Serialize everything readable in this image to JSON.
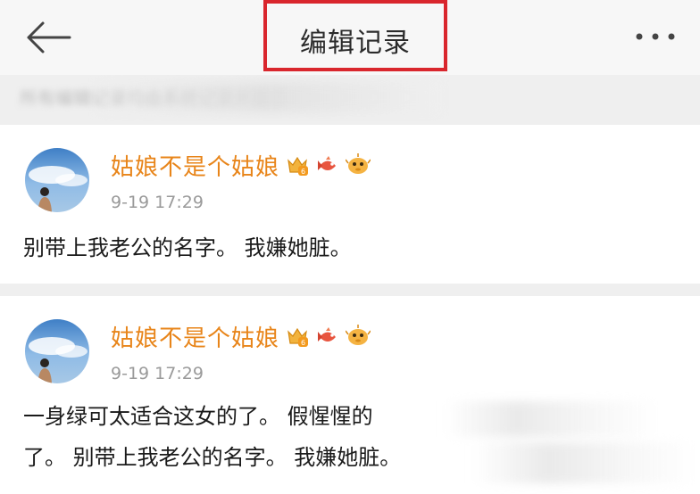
{
  "header": {
    "title": "编辑记录",
    "back_icon": "arrow-left-icon",
    "more_icon": "more-dots-icon",
    "title_highlight_color": "#d9262d"
  },
  "notice": {
    "text": "所有编辑记录均由系统记录并展示"
  },
  "records": [
    {
      "username": "姑娘不是个姑娘",
      "timestamp": "9-19 17:29",
      "lines": [
        "别带上我老公的名字。 我嫌她脏。"
      ]
    },
    {
      "username": "姑娘不是个姑娘",
      "timestamp": "9-19 17:29",
      "lines": [
        "一身绿可太适合这女的了。 假惺惺的",
        "了。 别带上我老公的名字。 我嫌她脏。"
      ]
    }
  ],
  "colors": {
    "username": "#e8851a",
    "timestamp": "#9a9a9a",
    "background": "#efefef",
    "card": "#ffffff"
  }
}
